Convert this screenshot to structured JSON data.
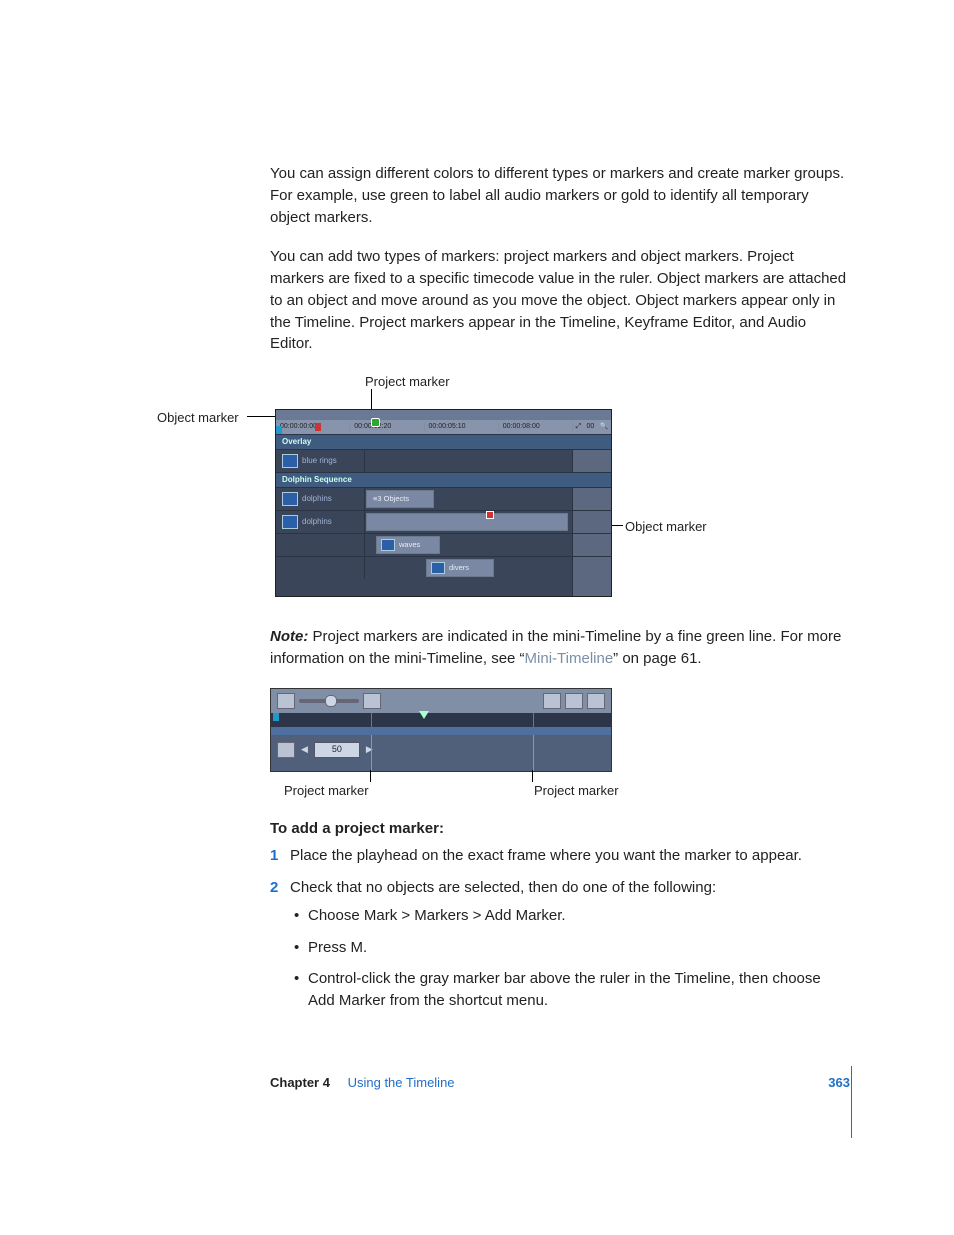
{
  "paragraphs": {
    "p1": "You can assign different colors to different types or markers and create marker groups. For example, use green to label all audio markers or gold to identify all temporary object markers.",
    "p2": "You can add two types of markers:  project markers and object markers. Project markers are fixed to a specific timecode value in the ruler. Object markers are attached to an object and move around as you move the object. Object markers appear only in the Timeline. Project markers appear in the Timeline, Keyframe Editor, and Audio Editor."
  },
  "fig1": {
    "labels": {
      "project_marker": "Project marker",
      "object_marker_left": "Object marker",
      "object_marker_right": "Object marker"
    },
    "ruler": [
      "00:00:00:00",
      "00:00:02:20",
      "00:00:05:10",
      "00:00:08:00"
    ],
    "ruler_end": "00",
    "groups": {
      "overlay": "Overlay",
      "dolphin_sequence": "Dolphin Sequence"
    },
    "tracks": {
      "blue_rings": "blue rings",
      "dolphins1": "dolphins",
      "dolphins2": "dolphins",
      "waves": "waves",
      "divers": "divers"
    },
    "clip_count": "3 Objects"
  },
  "note": {
    "prefix": "Note:",
    "text_before_link": "  Project markers are indicated in the mini-Timeline by a fine green line. For more information on the mini-Timeline, see “",
    "link": "Mini-Timeline",
    "text_after_link": "” on page 61."
  },
  "fig2": {
    "numbox": "50",
    "labels": {
      "left": "Project marker",
      "right": "Project marker"
    }
  },
  "procedure": {
    "heading": "To add a project marker:",
    "steps": {
      "s1": "Place the playhead on the exact frame where you want the marker to appear.",
      "s2": "Check that no objects are selected, then do one of the following:"
    },
    "bullets": {
      "b1": "Choose Mark > Markers > Add Marker.",
      "b2": "Press M.",
      "b3": "Control-click the gray marker bar above the ruler in the Timeline, then choose Add Marker from the shortcut menu."
    }
  },
  "footer": {
    "chapter": "Chapter 4",
    "title": "Using the Timeline",
    "page": "363"
  }
}
